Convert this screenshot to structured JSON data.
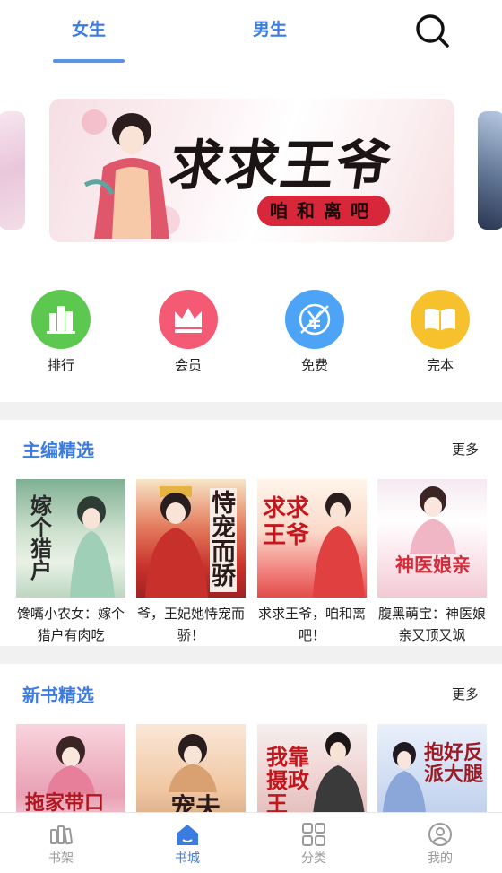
{
  "top_tabs": [
    {
      "label": "女生",
      "active": true
    },
    {
      "label": "男生",
      "active": false
    }
  ],
  "search": {
    "icon": "search-icon"
  },
  "banner": {
    "title": "求求王爷",
    "subtitle": "咱和离吧"
  },
  "categories": [
    {
      "label": "排行",
      "icon": "ranking-icon",
      "color": "#5cc84f"
    },
    {
      "label": "会员",
      "icon": "crown-icon",
      "color": "#f45a74"
    },
    {
      "label": "免费",
      "icon": "yen-icon",
      "color": "#4da3f5"
    },
    {
      "label": "完本",
      "icon": "book-icon",
      "color": "#f7c12e"
    }
  ],
  "sections": [
    {
      "title": "主编精选",
      "more": "更多",
      "books": [
        {
          "title": "馋嘴小农女：嫁个猎户有肉吃",
          "cover_text": "嫁个猎户"
        },
        {
          "title": "爷，王妃她恃宠而骄！",
          "cover_text": "恃宠而骄"
        },
        {
          "title": "求求王爷，咱和离吧！",
          "cover_text": "求求王爷"
        },
        {
          "title": "腹黑萌宝：神医娘亲又顶又飒",
          "cover_text": "神医娘亲"
        }
      ]
    },
    {
      "title": "新书精选",
      "more": "更多",
      "books": [
        {
          "title": "",
          "cover_text": "拖家带口"
        },
        {
          "title": "",
          "cover_text": "宠夫"
        },
        {
          "title": "",
          "cover_text": "我靠摄政王"
        },
        {
          "title": "",
          "cover_text": "抱好反派大腿"
        }
      ]
    }
  ],
  "bottom_nav": [
    {
      "label": "书架",
      "icon": "bookshelf-icon",
      "active": false
    },
    {
      "label": "书城",
      "icon": "home-icon",
      "active": true
    },
    {
      "label": "分类",
      "icon": "grid-icon",
      "active": false
    },
    {
      "label": "我的",
      "icon": "profile-icon",
      "active": false
    }
  ],
  "colors": {
    "accent": "#3b7ce0",
    "inactive": "#9a9a9a",
    "divider": "#f1f1f1"
  }
}
